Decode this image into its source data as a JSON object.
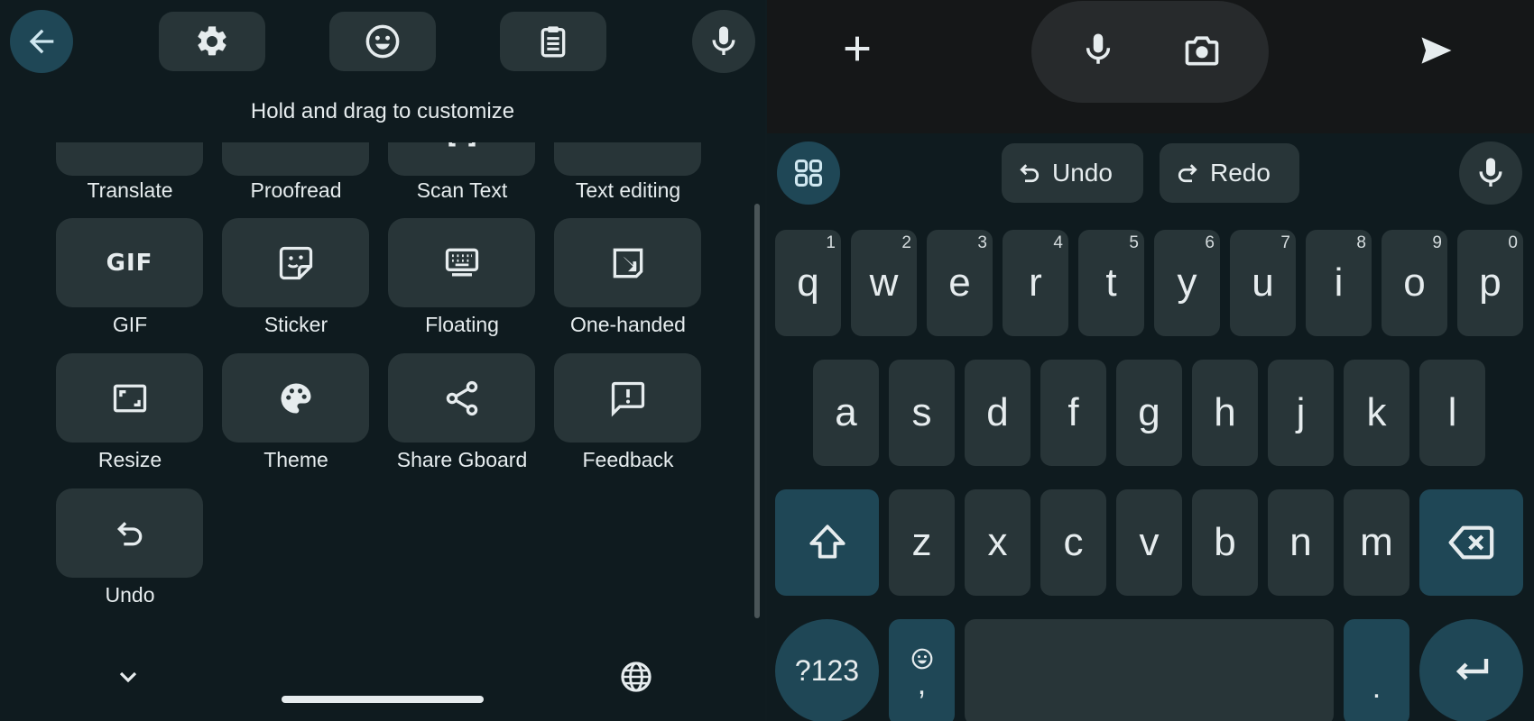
{
  "left_panel": {
    "hint": "Hold and drag to customize",
    "toolbar": [
      "back-arrow-icon",
      "settings-icon",
      "emoji-icon",
      "clipboard-icon",
      "microphone-icon"
    ],
    "tiles": [
      {
        "label": "Translate",
        "icon": "translate-icon"
      },
      {
        "label": "Proofread",
        "icon": "proofread-icon"
      },
      {
        "label": "Scan Text",
        "icon": "scan-text-icon"
      },
      {
        "label": "Text editing",
        "icon": "text-editing-icon"
      },
      {
        "label": "GIF",
        "icon": "gif-icon",
        "icon_text": "GIF"
      },
      {
        "label": "Sticker",
        "icon": "sticker-icon"
      },
      {
        "label": "Floating",
        "icon": "floating-keyboard-icon"
      },
      {
        "label": "One-handed",
        "icon": "one-handed-icon"
      },
      {
        "label": "Resize",
        "icon": "resize-icon"
      },
      {
        "label": "Theme",
        "icon": "palette-icon"
      },
      {
        "label": "Share Gboard",
        "icon": "share-icon"
      },
      {
        "label": "Feedback",
        "icon": "feedback-icon"
      },
      {
        "label": "Undo",
        "icon": "undo-icon"
      }
    ],
    "footer": [
      "chevron-down-icon",
      "globe-icon"
    ]
  },
  "compose_bar": {
    "icons": [
      "plus-icon",
      "microphone-icon",
      "camera-icon",
      "send-icon"
    ]
  },
  "suggestion_bar": {
    "undo_label": "Undo",
    "redo_label": "Redo"
  },
  "keyboard": {
    "row1": [
      {
        "key": "q",
        "num": "1"
      },
      {
        "key": "w",
        "num": "2"
      },
      {
        "key": "e",
        "num": "3"
      },
      {
        "key": "r",
        "num": "4"
      },
      {
        "key": "t",
        "num": "5"
      },
      {
        "key": "y",
        "num": "6"
      },
      {
        "key": "u",
        "num": "7"
      },
      {
        "key": "i",
        "num": "8"
      },
      {
        "key": "o",
        "num": "9"
      },
      {
        "key": "p",
        "num": "0"
      }
    ],
    "row2": [
      "a",
      "s",
      "d",
      "f",
      "g",
      "h",
      "j",
      "k",
      "l"
    ],
    "row3": [
      "z",
      "x",
      "c",
      "v",
      "b",
      "n",
      "m"
    ],
    "symbols_label": "?123",
    "comma_label": ",",
    "period_label": ".",
    "accent_color": "#1f4756",
    "key_color": "#283538"
  }
}
